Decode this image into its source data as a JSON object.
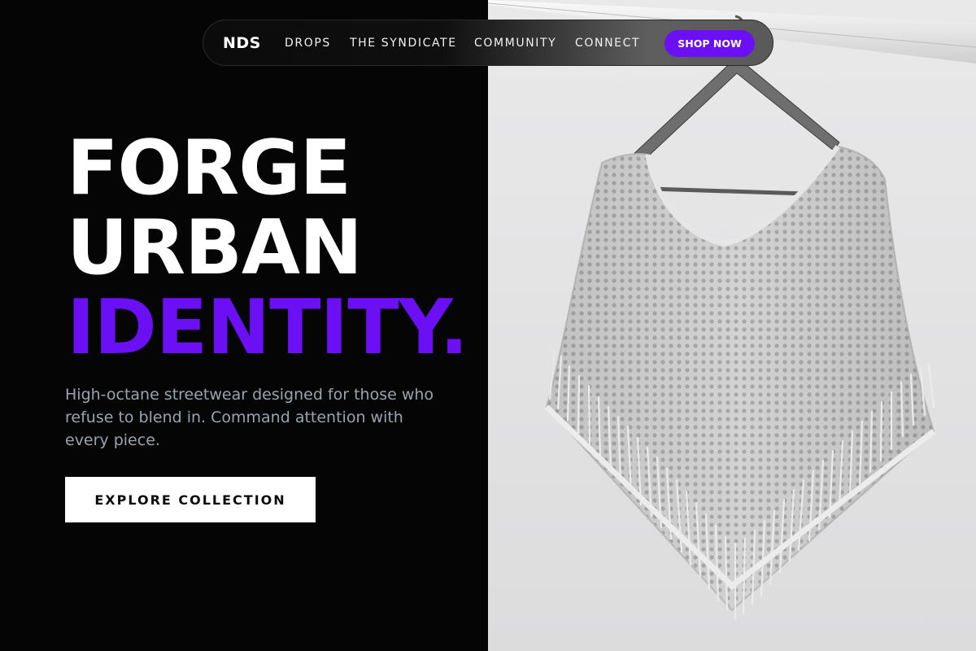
{
  "nav": {
    "brand": "NDS",
    "links": [
      {
        "label": "DROPS"
      },
      {
        "label": "THE SYNDICATE"
      },
      {
        "label": "COMMUNITY"
      },
      {
        "label": "CONNECT"
      }
    ],
    "cta_label": "SHOP NOW"
  },
  "hero": {
    "line1": "FORGE",
    "line2": "URBAN",
    "line3": "IDENTITY.",
    "subtitle": "High-octane streetwear designed for those who refuse to blend in. Command attention with every piece.",
    "cta_label": "EXPLORE COLLECTION"
  },
  "colors": {
    "accent": "#6b0ff5",
    "background": "#050505",
    "subtitle_text": "#9ca3af",
    "cta_background": "#ffffff"
  }
}
